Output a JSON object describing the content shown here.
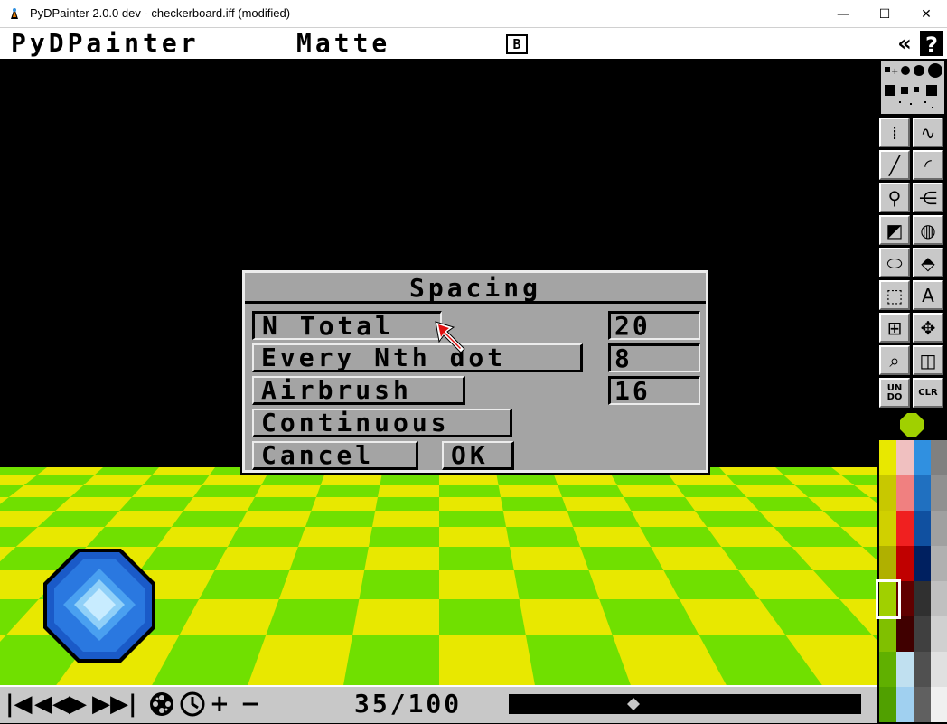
{
  "window": {
    "title": "PyDPainter 2.0.0 dev - checkerboard.iff (modified)",
    "icon": "pydpainter-app-icon",
    "controls": {
      "minimize": "—",
      "maximize": "☐",
      "close": "✕"
    }
  },
  "menubar": {
    "app_name": "PyDPainter",
    "mode": "Matte",
    "mode_icon_label": "B",
    "collapse_label": "«",
    "help_label": "?"
  },
  "dialog": {
    "title": "Spacing",
    "options": [
      {
        "label": "N Total",
        "selected": true
      },
      {
        "label": "Every Nth dot",
        "selected": false
      },
      {
        "label": "Airbrush",
        "selected": false
      },
      {
        "label": "Continuous",
        "selected": false
      }
    ],
    "fields": {
      "n_total": "20",
      "every_nth": "8",
      "airbrush": "16"
    },
    "cancel_label": "Cancel",
    "ok_label": "OK"
  },
  "animbar": {
    "first_frame": "|◀",
    "prev_fast": "◀◀",
    "play": "▶",
    "next_fast": "▶▶|",
    "frame_counter": "35/100",
    "add_label": "+",
    "remove_label": "−"
  },
  "toolbox": {
    "tools": [
      {
        "name": "dotted-freehand-tool",
        "glyph": "⁞"
      },
      {
        "name": "continuous-freehand-tool",
        "glyph": "∿"
      },
      {
        "name": "line-tool",
        "glyph": "╱"
      },
      {
        "name": "curve-tool",
        "glyph": "◜"
      },
      {
        "name": "fill-tool",
        "glyph": "⚲"
      },
      {
        "name": "airbrush-tool",
        "glyph": "⋲"
      },
      {
        "name": "rectangle-tool",
        "glyph": "◩"
      },
      {
        "name": "circle-tool",
        "glyph": "◍"
      },
      {
        "name": "ellipse-tool",
        "glyph": "⬭"
      },
      {
        "name": "polygon-tool",
        "glyph": "⬘"
      },
      {
        "name": "brush-select-tool",
        "glyph": "⬚"
      },
      {
        "name": "text-tool",
        "glyph": "A"
      },
      {
        "name": "grid-tool",
        "glyph": "⊞"
      },
      {
        "name": "symmetry-tool",
        "glyph": "✥"
      },
      {
        "name": "magnify-tool",
        "glyph": "⌕"
      },
      {
        "name": "zoom-tool",
        "glyph": "◫"
      },
      {
        "name": "undo-tool",
        "glyph": "UN DO"
      },
      {
        "name": "clear-tool",
        "glyph": "CLR"
      }
    ]
  },
  "colors": {
    "floor_yellow": "#e8e800",
    "floor_green": "#70e000",
    "current_color": "#a0d000",
    "palette": [
      [
        "#e8e800",
        "#f0c0c0",
        "#3090e0",
        "#808080"
      ],
      [
        "#c8c800",
        "#f08080",
        "#2070c0",
        "#909090"
      ],
      [
        "#d0d000",
        "#f02020",
        "#1050a0",
        "#a0a0a0"
      ],
      [
        "#b0b000",
        "#c00000",
        "#002060",
        "#b0b0b0"
      ],
      [
        "#a0d000",
        "#600000",
        "#303030",
        "#c0c0c0"
      ],
      [
        "#80c000",
        "#400000",
        "#404040",
        "#d0d0d0"
      ],
      [
        "#60b000",
        "#c0e0f0",
        "#505050",
        "#e0e0e0"
      ],
      [
        "#50a000",
        "#a0d0f0",
        "#606060",
        "#f0f0f0"
      ]
    ]
  }
}
